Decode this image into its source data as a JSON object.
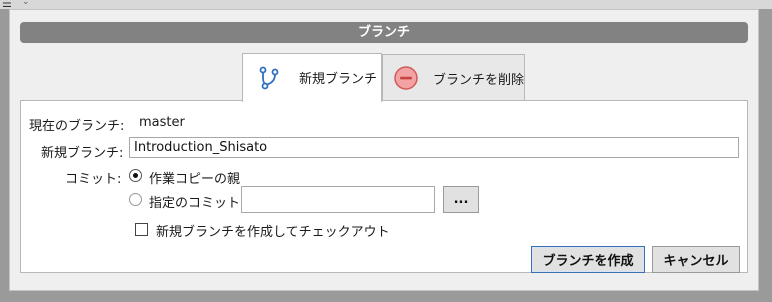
{
  "window": {
    "title": "ブランチ"
  },
  "tabs": [
    {
      "label": "新規ブランチ",
      "icon": "branch-icon",
      "active": true
    },
    {
      "label": "ブランチを削除",
      "icon": "delete-minus-icon",
      "active": false
    }
  ],
  "form": {
    "current_branch_label": "現在のブランチ:",
    "current_branch_value": "master",
    "new_branch_label": "新規ブランチ:",
    "new_branch_value": "Introduction_Shisato",
    "commit_label": "コミット:",
    "radio_working_copy": "作業コピーの親",
    "radio_specified": "指定のコミット:",
    "specified_commit_value": "",
    "browse_label": "...",
    "checkout_label": "新規ブランチを作成してチェックアウト"
  },
  "buttons": {
    "create": "ブランチを作成",
    "cancel": "キャンセル"
  },
  "colors": {
    "title_bar": "#828282",
    "delete_icon": "#e07070",
    "branch_icon": "#2f6fc0"
  }
}
